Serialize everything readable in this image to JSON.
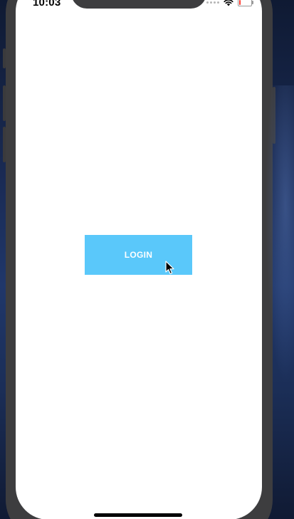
{
  "status_bar": {
    "time": "10:03",
    "battery_level": 0.1,
    "icons": [
      "signal-dots-icon",
      "wifi-icon",
      "battery-icon"
    ]
  },
  "main": {
    "login_label": "LOGIN"
  },
  "colors": {
    "login_button": "#5ac8fa",
    "login_text": "#ffffff",
    "screen_background": "#ffffff",
    "device_frame": "#3d3d3f",
    "battery_low": "#ff3b30"
  }
}
